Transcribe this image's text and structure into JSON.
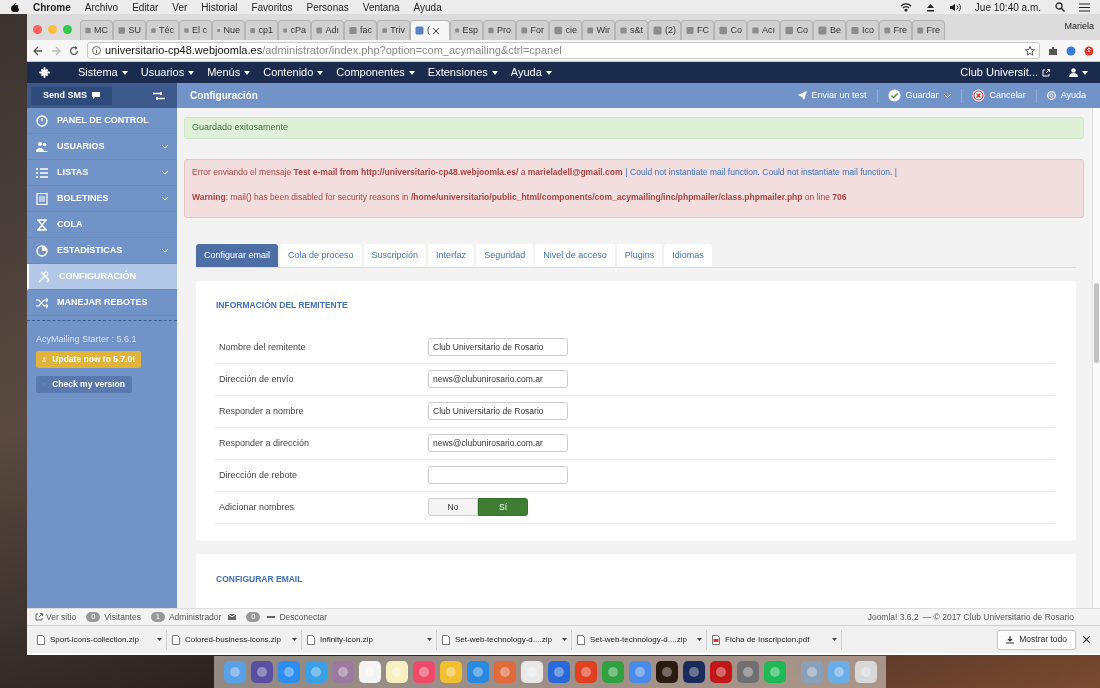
{
  "mac_menubar": {
    "app": "Chrome",
    "menus": [
      "Archivo",
      "Editar",
      "Ver",
      "Historial",
      "Favoritos",
      "Personas",
      "Ventana",
      "Ayuda"
    ],
    "clock": "Jue 10:40 a.m."
  },
  "browser": {
    "tabs": [
      {
        "title": "MC",
        "selected": false
      },
      {
        "title": "SU",
        "selected": false
      },
      {
        "title": "Téc",
        "selected": false
      },
      {
        "title": "El c",
        "selected": false
      },
      {
        "title": "Nue",
        "selected": false
      },
      {
        "title": "cp1",
        "selected": false
      },
      {
        "title": "cPa",
        "selected": false
      },
      {
        "title": "Adı",
        "selected": false
      },
      {
        "title": "fac",
        "selected": false
      },
      {
        "title": "Triv",
        "selected": false
      },
      {
        "title": "(",
        "selected": true
      },
      {
        "title": "Esp",
        "selected": false
      },
      {
        "title": "Pro",
        "selected": false
      },
      {
        "title": "For",
        "selected": false
      },
      {
        "title": "cie",
        "selected": false
      },
      {
        "title": "Wir",
        "selected": false
      },
      {
        "title": "s&t",
        "selected": false
      },
      {
        "title": "(2)",
        "selected": false
      },
      {
        "title": "FC",
        "selected": false
      },
      {
        "title": "Co",
        "selected": false
      },
      {
        "title": "Acı",
        "selected": false
      },
      {
        "title": "Co",
        "selected": false
      },
      {
        "title": "Be",
        "selected": false
      },
      {
        "title": "Ico",
        "selected": false
      },
      {
        "title": "Fre",
        "selected": false
      },
      {
        "title": "Fre",
        "selected": false
      }
    ],
    "profile": "Mariela",
    "url": {
      "host": "universitario-cp48.webjoomla.es",
      "path": "/administrator/index.php?option=com_acymailing&ctrl=cpanel"
    }
  },
  "joomla_nav": {
    "menus": [
      "Sistema",
      "Usuarios",
      "Menús",
      "Contenido",
      "Componentes",
      "Extensiones",
      "Ayuda"
    ],
    "site_link": "Club Universit..."
  },
  "toolbar": {
    "sms_button": "Send SMS",
    "title": "Configuración",
    "actions": [
      {
        "kind": "send",
        "label": "Enviar un test"
      },
      {
        "kind": "save",
        "label": "Guardar"
      },
      {
        "kind": "cancel",
        "label": "Cancelar"
      },
      {
        "kind": "help",
        "label": "Ayuda"
      }
    ]
  },
  "sidebar": {
    "items": [
      {
        "kind": "dashboard",
        "label": "PANEL DE CONTROL",
        "selected": false,
        "expandable": false
      },
      {
        "kind": "users",
        "label": "USUARIOS",
        "selected": false,
        "expandable": true
      },
      {
        "kind": "lists",
        "label": "LISTAS",
        "selected": false,
        "expandable": true
      },
      {
        "kind": "newsletter",
        "label": "BOLETINES",
        "selected": false,
        "expandable": true
      },
      {
        "kind": "queue",
        "label": "COLA",
        "selected": false,
        "expandable": false
      },
      {
        "kind": "stats",
        "label": "ESTADÍSTICAS",
        "selected": false,
        "expandable": true
      },
      {
        "kind": "config",
        "label": "CONFIGURACIÓN",
        "selected": true,
        "expandable": false
      },
      {
        "kind": "bounce",
        "label": "MANEJAR REBOTES",
        "selected": false,
        "expandable": false
      }
    ],
    "version": "AcyMailing Starter : 5.6.1",
    "update_button": "Update now to 5.7.0!",
    "check_button": "Check my version"
  },
  "alerts": {
    "success": "Guardado exitosamente",
    "error_message": "Error enviando el mensaje **Test e-mail from http://universitario-cp48.webjoomla.es/** a **marieladell@gmail.com**",
    "error_detail": "| Could not instantiate mail function. Could not instantiate mail function. |",
    "warning": "**Warning**: mail() has been disabled for security reasons in **/home/universitario/public_html/components/com_acymailing/inc/phpmailer/class.phpmailer.php** on line **706**"
  },
  "config_tabs": [
    {
      "label": "Configurar email",
      "selected": true
    },
    {
      "label": "Cola de proceso",
      "selected": false
    },
    {
      "label": "Suscripción",
      "selected": false
    },
    {
      "label": "Interfaz",
      "selected": false
    },
    {
      "label": "Seguridad",
      "selected": false
    },
    {
      "label": "Nivel de acceso",
      "selected": false
    },
    {
      "label": "Plugins",
      "selected": false
    },
    {
      "label": "Idiomas",
      "selected": false
    }
  ],
  "sender_section": {
    "title": "INFORMACIÓN DEL REMITENTE",
    "fields": [
      {
        "kind": "text",
        "label": "Nombre del remitente",
        "value": "Club Universitario de Rosario"
      },
      {
        "kind": "text",
        "label": "Dirección de envío",
        "value": "news@clubunirosario.com.ar"
      },
      {
        "kind": "text",
        "label": "Responder a nombre",
        "value": "Club Universitario de Rosario"
      },
      {
        "kind": "text",
        "label": "Responder a dirección",
        "value": "news@clubunirosario.com.ar"
      },
      {
        "kind": "text",
        "label": "Dirección de rebote"
      },
      {
        "kind": "toggle",
        "label": "Adicionar nombres",
        "options": [
          {
            "label": "No",
            "selected": false
          },
          {
            "label": "Sí",
            "selected": true
          }
        ]
      }
    ]
  },
  "email_section": {
    "title": "CONFIGURAR EMAIL"
  },
  "status_bar": {
    "view_site": "Ver sitio",
    "visitors_count": "0",
    "visitors": "Visitantes",
    "admins_count": "1",
    "admins": "Administrador",
    "messages_count": "0",
    "logout": "Desconectar",
    "version": "Joomla! 3.6.2",
    "copyright": "— © 2017 Club Universitario de Rosario"
  },
  "downloads": {
    "files": [
      {
        "kind": "zip",
        "name": "Sport-icons-collection.zip"
      },
      {
        "kind": "zip",
        "name": "Colored-business-icons.zip"
      },
      {
        "kind": "zip",
        "name": "Infinity-icon.zip"
      },
      {
        "kind": "zip",
        "name": "Set-web-technology-d....zip"
      },
      {
        "kind": "zip",
        "name": "Set-web-technology-d....zip"
      },
      {
        "kind": "pdf",
        "name": "Ficha de Inscripcion.pdf"
      }
    ],
    "show_all": "Mostrar todo"
  }
}
